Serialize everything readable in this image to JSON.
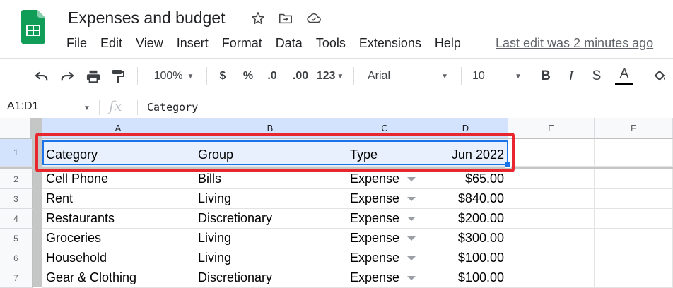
{
  "app": {
    "doc_title": "Expenses and budget",
    "last_edit": "Last edit was 2 minutes ago"
  },
  "menu": [
    "File",
    "Edit",
    "View",
    "Insert",
    "Format",
    "Data",
    "Tools",
    "Extensions",
    "Help"
  ],
  "toolbar": {
    "zoom": "100%",
    "currency": "$",
    "percent": "%",
    "decrease_decimal": ".0",
    "increase_decimal": ".00",
    "more_formats": "123",
    "font": "Arial",
    "font_size": "10",
    "bold": "B",
    "italic": "I",
    "strikethrough": "S",
    "text_color": "A"
  },
  "formula_bar": {
    "name_box": "A1:D1",
    "fx": "fx",
    "value": "Category"
  },
  "columns": [
    "A",
    "B",
    "C",
    "D",
    "E",
    "F"
  ],
  "rows": [
    {
      "n": "1",
      "category": "Category",
      "group": "Group",
      "type": "Type",
      "amount": "Jun 2022"
    },
    {
      "n": "2",
      "category": "Cell Phone",
      "group": "Bills",
      "type": "Expense",
      "amount": "$65.00"
    },
    {
      "n": "3",
      "category": "Rent",
      "group": "Living",
      "type": "Expense",
      "amount": "$840.00"
    },
    {
      "n": "4",
      "category": "Restaurants",
      "group": "Discretionary",
      "type": "Expense",
      "amount": "$200.00"
    },
    {
      "n": "5",
      "category": "Groceries",
      "group": "Living",
      "type": "Expense",
      "amount": "$300.00"
    },
    {
      "n": "6",
      "category": "Household",
      "group": "Living",
      "type": "Expense",
      "amount": "$100.00"
    },
    {
      "n": "7",
      "category": "Gear & Clothing",
      "group": "Discretionary",
      "type": "Expense",
      "amount": "$100.00"
    }
  ],
  "colors": {
    "accent": "#1a73e8",
    "highlight": "#e8262d",
    "sheets_green": "#0f9d58"
  }
}
